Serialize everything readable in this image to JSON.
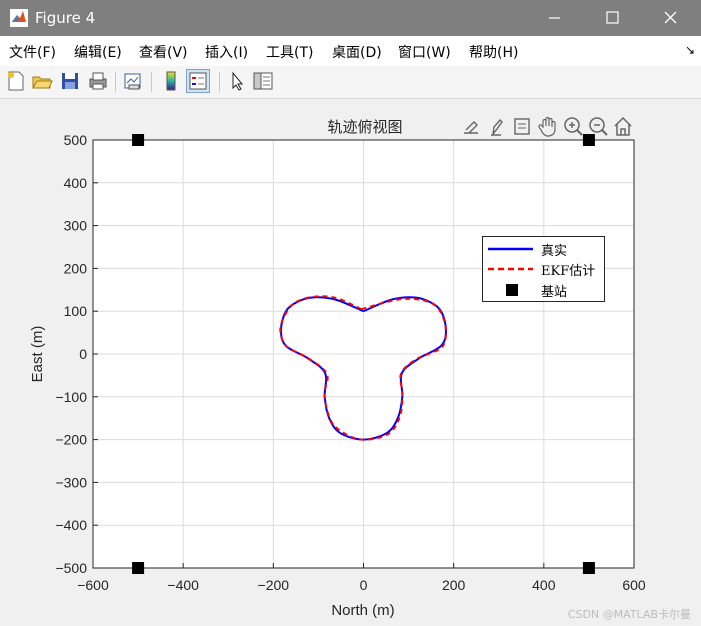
{
  "window": {
    "title": "Figure 4",
    "controls": [
      "minimize",
      "maximize",
      "close"
    ]
  },
  "menu": {
    "items": [
      "文件(F)",
      "编辑(E)",
      "查看(V)",
      "插入(I)",
      "工具(T)",
      "桌面(D)",
      "窗口(W)",
      "帮助(H)"
    ]
  },
  "toolbar": {
    "buttons": [
      "new-figure-icon",
      "open-file-icon",
      "save-icon",
      "print-icon",
      "link-plot-icon",
      "insert-colorbar-icon",
      "insert-legend-icon",
      "edit-plot-icon",
      "property-inspector-icon"
    ]
  },
  "axes_toolbar": {
    "buttons": [
      "export-icon",
      "brush-icon",
      "data-tips-icon",
      "pan-icon",
      "zoom-in-icon",
      "zoom-out-icon",
      "home-icon"
    ]
  },
  "watermark": "CSDN @MATLAB卡尔曼",
  "chart_data": {
    "type": "line",
    "title": "轨迹俯视图",
    "xlabel": "North (m)",
    "ylabel": "East (m)",
    "xlim": [
      -600,
      600
    ],
    "ylim": [
      -500,
      500
    ],
    "xticks": [
      -600,
      -400,
      -200,
      0,
      200,
      400,
      600
    ],
    "yticks": [
      -500,
      -400,
      -300,
      -200,
      -100,
      0,
      100,
      200,
      300,
      400,
      500
    ],
    "grid": true,
    "legend_position": "top-right",
    "legend": [
      "真实",
      "EKF估计",
      "基站"
    ],
    "series": [
      {
        "name": "真实",
        "style": "solid",
        "color": "#0000ff",
        "curve": "three-lobed closed trajectory",
        "x": [
          0,
          62,
          114,
          150,
          173,
          183,
          172,
          122,
          85,
          86,
          76,
          51,
          0,
          -51,
          -76,
          -86,
          -85,
          -122,
          -172,
          -183,
          -173,
          -150,
          -114,
          -62,
          0
        ],
        "y": [
          100,
          127,
          132,
          120,
          98,
          55,
          19,
          -11,
          -45,
          -100,
          -150,
          -185,
          -200,
          -185,
          -150,
          -100,
          -45,
          -11,
          19,
          55,
          98,
          120,
          132,
          127,
          100
        ]
      },
      {
        "name": "EKF估计",
        "style": "dashed",
        "color": "#ff0000",
        "curve": "noisy estimate following the true trajectory"
      },
      {
        "name": "基站",
        "style": "marker-square",
        "color": "#000000",
        "x": [
          -500,
          500,
          -500,
          500
        ],
        "y": [
          500,
          500,
          -500,
          -500
        ]
      }
    ]
  }
}
